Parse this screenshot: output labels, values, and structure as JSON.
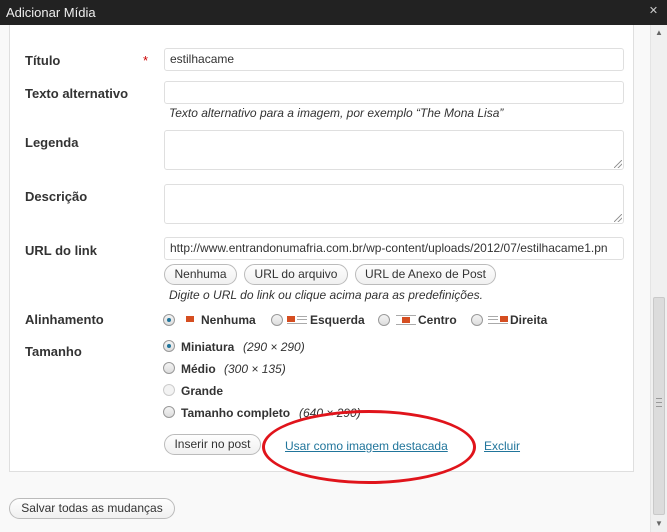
{
  "window": {
    "title": "Adicionar Mídia",
    "close_icon": "close-icon"
  },
  "fields": {
    "title": {
      "label": "Título",
      "required_mark": "*",
      "value": "estilhacame"
    },
    "alt": {
      "label": "Texto alternativo",
      "value": "",
      "hint": "Texto alternativo para a imagem, por exemplo “The Mona Lisa”"
    },
    "caption": {
      "label": "Legenda",
      "value": ""
    },
    "description": {
      "label": "Descrição",
      "value": ""
    },
    "link_url": {
      "label": "URL do link",
      "value": "http://www.entrandonumafria.com.br/wp-content/uploads/2012/07/estilhacame1.pn",
      "buttons": [
        "Nenhuma",
        "URL do arquivo",
        "URL de Anexo de Post"
      ],
      "hint": "Digite o URL do link ou clique acima para as predefinições."
    },
    "alignment": {
      "label": "Alinhamento",
      "options": [
        "Nenhuma",
        "Esquerda",
        "Centro",
        "Direita"
      ],
      "selected": "Nenhuma"
    },
    "size": {
      "label": "Tamanho",
      "options": [
        {
          "name": "Miniatura",
          "dims": "(290 × 290)",
          "selected": true,
          "enabled": true
        },
        {
          "name": "Médio",
          "dims": "(300 × 135)",
          "selected": false,
          "enabled": true
        },
        {
          "name": "Grande",
          "dims": "",
          "selected": false,
          "enabled": false
        },
        {
          "name": "Tamanho completo",
          "dims": "(640 × 290)",
          "selected": false,
          "enabled": true
        }
      ]
    }
  },
  "actions": {
    "insert": "Inserir no post",
    "featured": "Usar como imagem destacada",
    "delete": "Excluir",
    "save_all": "Salvar todas as mudanças"
  },
  "colors": {
    "accent_link": "#21759b",
    "highlight_ellipse": "#e0141b",
    "align_icon": "#d54e21"
  }
}
